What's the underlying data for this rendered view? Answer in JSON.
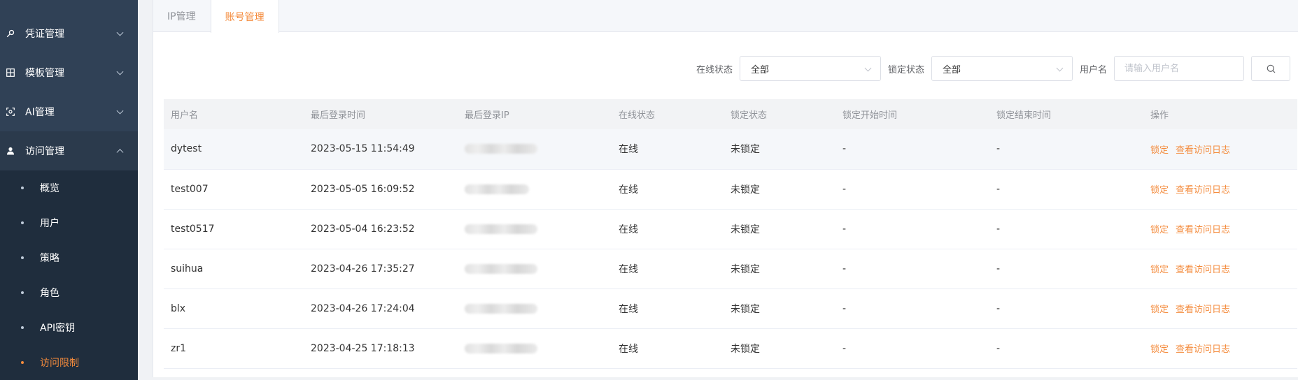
{
  "sidebar": {
    "menus": [
      {
        "label": "凭证管理",
        "icon": "key-icon"
      },
      {
        "label": "模板管理",
        "icon": "grid-icon"
      },
      {
        "label": "AI管理",
        "icon": "ai-scan-icon"
      },
      {
        "label": "访问管理",
        "icon": "user-icon",
        "open": true
      }
    ],
    "submenu": [
      {
        "label": "概览"
      },
      {
        "label": "用户"
      },
      {
        "label": "策略"
      },
      {
        "label": "角色"
      },
      {
        "label": "API密钥"
      },
      {
        "label": "访问限制",
        "active": true
      }
    ]
  },
  "tabs": [
    {
      "label": "IP管理"
    },
    {
      "label": "账号管理",
      "active": true
    }
  ],
  "filter": {
    "online_label": "在线状态",
    "online_value": "全部",
    "lock_label": "锁定状态",
    "lock_value": "全部",
    "username_label": "用户名",
    "username_placeholder": "请输入用户名",
    "search_icon": "search-icon"
  },
  "table": {
    "headers": [
      "用户名",
      "最后登录时间",
      "最后登录IP",
      "在线状态",
      "锁定状态",
      "锁定开始时间",
      "锁定结束时间",
      "操作"
    ],
    "rows": [
      {
        "username": "dytest",
        "last_login": "2023-05-15 11:54:49",
        "status": "在线",
        "lock": "未锁定",
        "lock_start": "-",
        "lock_end": "-",
        "action_lock": "锁定",
        "action_log": "查看访问日志"
      },
      {
        "username": "test007",
        "last_login": "2023-05-05 16:09:52",
        "status": "在线",
        "lock": "未锁定",
        "lock_start": "-",
        "lock_end": "-",
        "action_lock": "锁定",
        "action_log": "查看访问日志"
      },
      {
        "username": "test0517",
        "last_login": "2023-05-04 16:23:52",
        "status": "在线",
        "lock": "未锁定",
        "lock_start": "-",
        "lock_end": "-",
        "action_lock": "锁定",
        "action_log": "查看访问日志"
      },
      {
        "username": "suihua",
        "last_login": "2023-04-26 17:35:27",
        "status": "在线",
        "lock": "未锁定",
        "lock_start": "-",
        "lock_end": "-",
        "action_lock": "锁定",
        "action_log": "查看访问日志"
      },
      {
        "username": "blx",
        "last_login": "2023-04-26 17:24:04",
        "status": "在线",
        "lock": "未锁定",
        "lock_start": "-",
        "lock_end": "-",
        "action_lock": "锁定",
        "action_log": "查看访问日志"
      },
      {
        "username": "zr1",
        "last_login": "2023-04-25 17:18:13",
        "status": "在线",
        "lock": "未锁定",
        "lock_start": "-",
        "lock_end": "-",
        "action_lock": "锁定",
        "action_log": "查看访问日志"
      }
    ]
  },
  "colors": {
    "sidebar_bg": "#304156",
    "submenu_bg": "#1f2d3d",
    "accent": "#f48b3c"
  }
}
